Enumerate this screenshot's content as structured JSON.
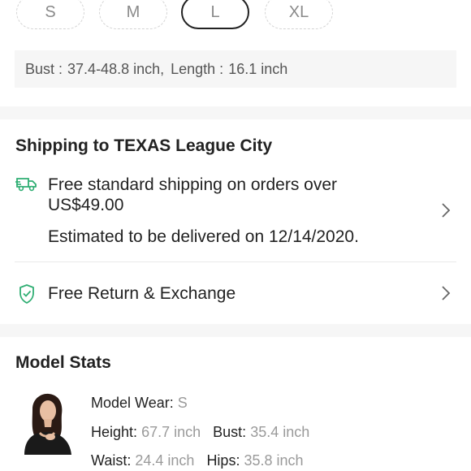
{
  "sizes": {
    "options": [
      "S",
      "M",
      "L",
      "XL"
    ],
    "selected": "L"
  },
  "measurements": {
    "bust_label": "Bust :",
    "bust_value": "37.4-48.8 inch,",
    "length_label": "Length :",
    "length_value": "16.1 inch"
  },
  "shipping": {
    "title": "Shipping to TEXAS League City",
    "icon": "truck-icon",
    "line1": "Free standard shipping on orders over",
    "line2": "US$49.00",
    "estimate": "Estimated to be delivered on 12/14/2020."
  },
  "returns": {
    "icon": "shield-check-icon",
    "label": "Free Return & Exchange"
  },
  "model_stats": {
    "title": "Model Stats",
    "wear_label": "Model Wear:",
    "wear_value": "S",
    "height_label": "Height:",
    "height_value": "67.7 inch",
    "bust_label": "Bust:",
    "bust_value": "35.4 inch",
    "waist_label": "Waist:",
    "waist_value": "24.4 inch",
    "hips_label": "Hips:",
    "hips_value": "35.8 inch"
  },
  "colors": {
    "accent_green": "#2fae73",
    "text_dark": "#222222",
    "text_muted": "#9a9a9a",
    "band_gray": "#f6f6f6"
  }
}
